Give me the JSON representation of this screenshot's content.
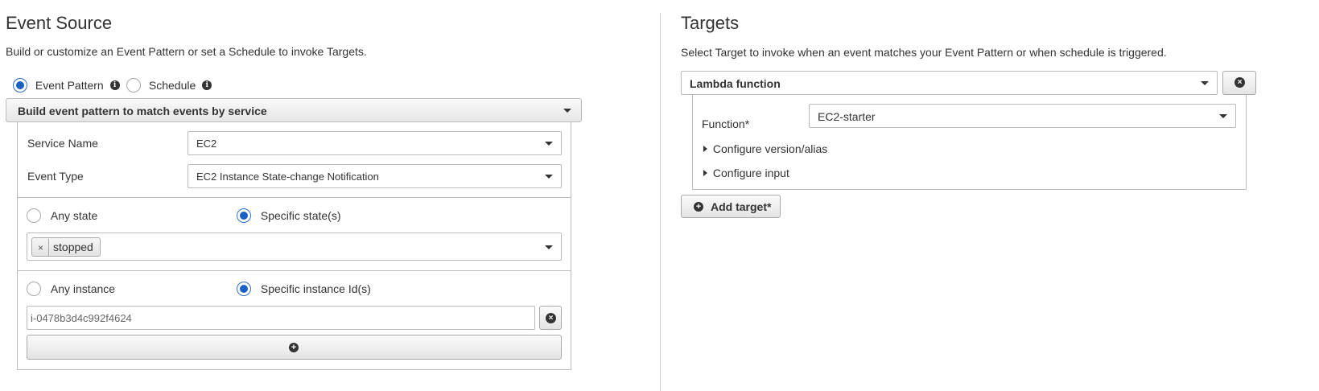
{
  "event_source": {
    "title": "Event Source",
    "description": "Build or customize an Event Pattern or set a Schedule to invoke Targets.",
    "mode_options": [
      {
        "label": "Event Pattern",
        "checked": true
      },
      {
        "label": "Schedule",
        "checked": false
      }
    ],
    "pattern_builder": "Build event pattern to match events by service",
    "service_name_label": "Service Name",
    "service_name_value": "EC2",
    "event_type_label": "Event Type",
    "event_type_value": "EC2 Instance State-change Notification",
    "state": {
      "any_label": "Any state",
      "specific_label": "Specific state(s)",
      "specific_checked": true,
      "selected_tags": [
        "stopped"
      ]
    },
    "instance": {
      "any_label": "Any instance",
      "specific_label": "Specific instance Id(s)",
      "specific_checked": true,
      "instance_id": "i-0478b3d4c992f4624"
    }
  },
  "targets": {
    "title": "Targets",
    "description": "Select Target to invoke when an event matches your Event Pattern or when schedule is triggered.",
    "target_type": "Lambda function",
    "function_label": "Function*",
    "function_value": "EC2-starter",
    "configure_version": "Configure version/alias",
    "configure_input": "Configure input",
    "add_target_label": "Add target*"
  },
  "colors": {
    "radio_checked": "#1a61c4",
    "border": "#bbbbbb",
    "text": "#333333"
  }
}
